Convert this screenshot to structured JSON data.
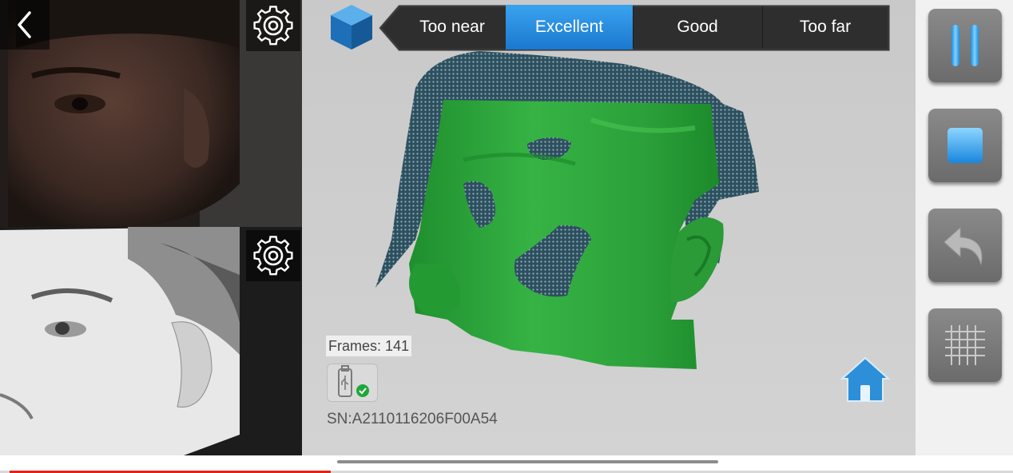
{
  "app": {
    "left_panel": {
      "back_icon": "chevron-left-icon",
      "texture_camera_settings_icon": "gear-icon",
      "ir_camera_settings_icon": "gear-icon"
    },
    "viewport": {
      "mode_icon": "cube-icon",
      "distance_indicator": {
        "segments": [
          "Too near",
          "Excellent",
          "Good",
          "Too far"
        ],
        "selected": "Excellent"
      },
      "frames_label": "Frames: 141",
      "usb_status_icon": "usb-connected-icon",
      "serial_number": "SN:A2110116206F00A54",
      "home_icon": "home-icon"
    },
    "controls": {
      "pause_icon": "pause-icon",
      "stop_icon": "stop-icon",
      "undo_icon": "undo-icon",
      "grid_icon": "grid-icon"
    },
    "video_progress_fraction": 0.32
  },
  "colors": {
    "accent_blue": "#1b78cf",
    "mesh_green": "#2fa33c",
    "progress_red": "#e62117",
    "button_gray": "#7a7a7a"
  }
}
